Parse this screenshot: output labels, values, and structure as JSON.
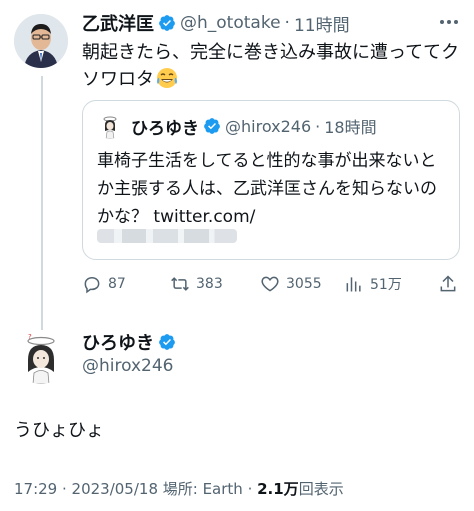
{
  "tweet": {
    "author_name": "乙武洋匡",
    "author_handle": "@h_ototake",
    "separator": "·",
    "time": "11時間",
    "text": "朝起きたら、完全に巻き込み事故に遭っててクソワロタ",
    "emoji_icon": "tears-of-joy-emoji",
    "quote": {
      "author_name": "ひろゆき",
      "author_handle": "@hirox246",
      "separator": "·",
      "time": "18時間",
      "text": "車椅子生活をしてると性的な事が出来ないとか主張する人は、乙武洋匡さんを知らないのかな？ twitter.com/"
    },
    "actions": {
      "replies": "87",
      "retweets": "383",
      "likes": "3055",
      "views": "51万"
    }
  },
  "main_tweet": {
    "author_name": "ひろゆき",
    "author_handle": "@hirox246",
    "text": "うひょひょ",
    "meta_time": "17:29 · 2023/05/18 場所: Earth · ",
    "meta_views_count": "2.1万",
    "meta_views_label": "回表示"
  },
  "colors": {
    "verified": "#1d9bf0",
    "secondary_text": "#536471",
    "border": "#cfd9de"
  }
}
